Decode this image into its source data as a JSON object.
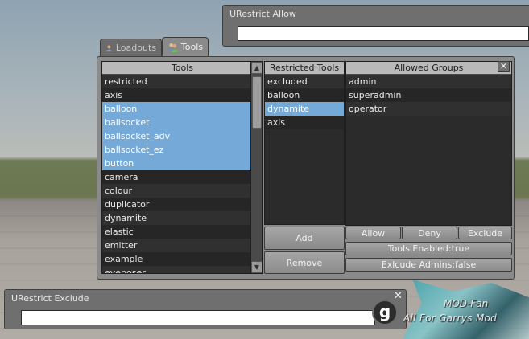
{
  "allow_window": {
    "title": "URestrict Allow",
    "input_value": ""
  },
  "exclude_window": {
    "title": "URestrict Exclude",
    "input_value": ""
  },
  "tabs": [
    {
      "label": "Loadouts",
      "icon": "user-icon",
      "active": false
    },
    {
      "label": "Tools",
      "icon": "users-icon",
      "active": true
    }
  ],
  "tools_list": {
    "header": "Tools",
    "items": [
      {
        "label": "restricted",
        "selected": false
      },
      {
        "label": "axis",
        "selected": false
      },
      {
        "label": "balloon",
        "selected": true
      },
      {
        "label": "ballsocket",
        "selected": true
      },
      {
        "label": "ballsocket_adv",
        "selected": true
      },
      {
        "label": "ballsocket_ez",
        "selected": true
      },
      {
        "label": "button",
        "selected": true
      },
      {
        "label": "camera",
        "selected": false
      },
      {
        "label": "colour",
        "selected": false
      },
      {
        "label": "duplicator",
        "selected": false
      },
      {
        "label": "dynamite",
        "selected": false
      },
      {
        "label": "elastic",
        "selected": false
      },
      {
        "label": "emitter",
        "selected": false
      },
      {
        "label": "example",
        "selected": false
      },
      {
        "label": "eyeposer",
        "selected": false
      }
    ]
  },
  "restricted_list": {
    "header": "Restricted Tools",
    "items": [
      {
        "label": "excluded",
        "selected": false
      },
      {
        "label": "balloon",
        "selected": false
      },
      {
        "label": "dynamite",
        "selected": true
      },
      {
        "label": "axis",
        "selected": false
      }
    ]
  },
  "groups_list": {
    "header": "Allowed Groups",
    "items": [
      {
        "label": "admin"
      },
      {
        "label": "superadmin"
      },
      {
        "label": "operator"
      }
    ]
  },
  "buttons": {
    "add": "Add",
    "remove": "Remove",
    "allow": "Allow",
    "deny": "Deny",
    "exclude": "Exclude",
    "tools_enabled": "Tools Enabled:true",
    "exclude_admins": "Exlcude Admins:false",
    "close": "✕"
  },
  "watermark": {
    "line1": "MOD-Fan",
    "line2": "All For Garrys Mod"
  },
  "logo_letter": "g",
  "colors": {
    "selection": "#74a9d8",
    "panel": "#8a8a8a",
    "list_bg": "#2b2b2b"
  }
}
